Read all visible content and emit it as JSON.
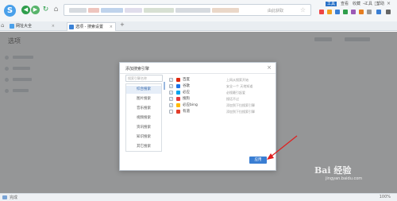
{
  "toolbar": {
    "brand_letter": "S",
    "address_hint": "由此获取",
    "top_menu": [
      "工具",
      "查看",
      "收藏",
      "工具",
      "帮助"
    ],
    "win_controls": "− □ ×"
  },
  "tabs": [
    {
      "label": "网址大全",
      "close": "×"
    },
    {
      "label": "选项 - 搜索设置",
      "close": "×"
    }
  ],
  "new_tab": "+",
  "home_glyph": "⌂",
  "page": {
    "title": "选项"
  },
  "dialog": {
    "title": "添加搜索引擎",
    "close": "×",
    "search_placeholder": "搜索引擎名称",
    "categories": [
      "综合搜索",
      "图片搜索",
      "音乐搜索",
      "视频搜索",
      "资讯搜索",
      "知识搜索",
      "其它搜索"
    ],
    "active_category": 0,
    "engines": [
      {
        "name": "百度",
        "desc": "上网从搜索开始",
        "checked": true,
        "color": "#de2910"
      },
      {
        "name": "谷歌",
        "desc": "安全一个 天地知道",
        "checked": true,
        "color": "#1a73e8"
      },
      {
        "name": "必应",
        "desc": "必搜最引起爱",
        "checked": true,
        "color": "#00a4ef"
      },
      {
        "name": "搜狗",
        "desc": "搜话不过",
        "checked": true,
        "color": "#e4393c"
      },
      {
        "name": "必应bing",
        "desc": "添加到下拉搜索引擎",
        "checked": true,
        "color": "#ffb900"
      },
      {
        "name": "有道",
        "desc": "添加到下拉搜索引擎",
        "checked": false,
        "color": "#e23e2b"
      }
    ],
    "ok_label": "应用"
  },
  "statusbar": {
    "text": "完成",
    "zoom": "100%"
  },
  "watermark": {
    "logo": "Bai 经验",
    "url": "jingyan.baidu.com"
  },
  "colors": {
    "accent": "#3a7ed3",
    "overlay": "#5a5a5a",
    "arrow": "#e02020"
  }
}
